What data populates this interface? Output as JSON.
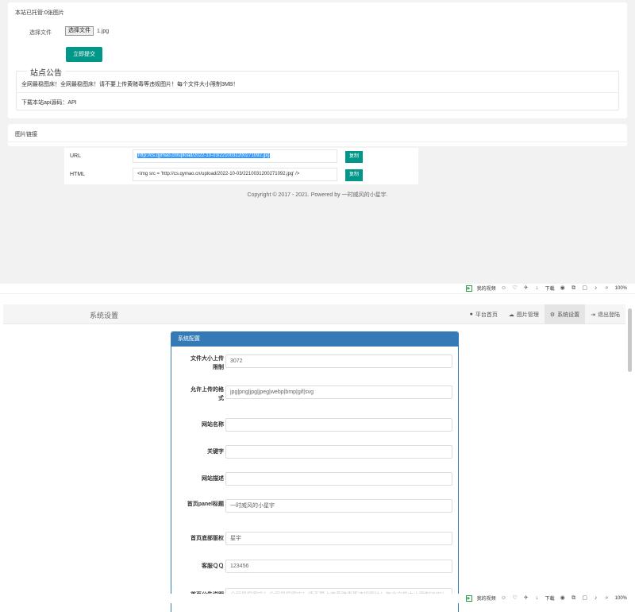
{
  "upload": {
    "header": "本站已托管:0张图片",
    "file_label": "选择文件",
    "file_button": "选择文件",
    "file_name": "1.jpg",
    "submit_label": "立即提交"
  },
  "notice": {
    "legend": "站点公告",
    "text": "全网最稳图床！全网最稳图床！请不要上传黄赌毒等违规图片！每个文件大小限制3MB！",
    "api_text": "下载本站api源码：API"
  },
  "links": {
    "header": "图片链接",
    "url_label": "URL",
    "url_value": "http://cs.qymao.cn/upload/2022-10-03/2210031200271092.jpg",
    "html_label": "HTML",
    "html_value": "<img src = 'http://cs.qymao.cn/upload/2022-10-03/2210031200271092.jpg' />",
    "copy_label": "复制"
  },
  "footer": {
    "copyright": "Copyright © 2017 - 2021. Powered by 一时威风的小星宇."
  },
  "statusbar": {
    "video_label": "我的视频",
    "download_label": "下载",
    "zoom": "100%"
  },
  "admin": {
    "brand": "系统设置",
    "nav": [
      {
        "label": "平台首页",
        "icon": "user-icon"
      },
      {
        "label": "图片管理",
        "icon": "cloud-icon"
      },
      {
        "label": "系统设置",
        "icon": "gear-icon"
      },
      {
        "label": "退出登陆",
        "icon": "logout-icon"
      }
    ],
    "panel_title": "系统配置",
    "fields": [
      {
        "label": "文件大小上传限制",
        "value": "3072"
      },
      {
        "label": "允许上传的格式",
        "value": "jpg|png|jpg|jpeg|webp|bmp|gif|svg"
      },
      {
        "label": "网站名称",
        "value": ""
      },
      {
        "label": "关键字",
        "value": ""
      },
      {
        "label": "网站描述",
        "value": ""
      },
      {
        "label": "首页panel标题",
        "value": "一时威风的小星宇"
      },
      {
        "label": "首页底部版权",
        "value": "星宇"
      },
      {
        "label": "客服ＱＱ",
        "value": "123456"
      },
      {
        "label": "首页公告说明",
        "value": "全网最稳图床！全网最稳图床！请不要上传黄赌毒等违规图片！每个文件大小限制3MB！"
      }
    ]
  }
}
